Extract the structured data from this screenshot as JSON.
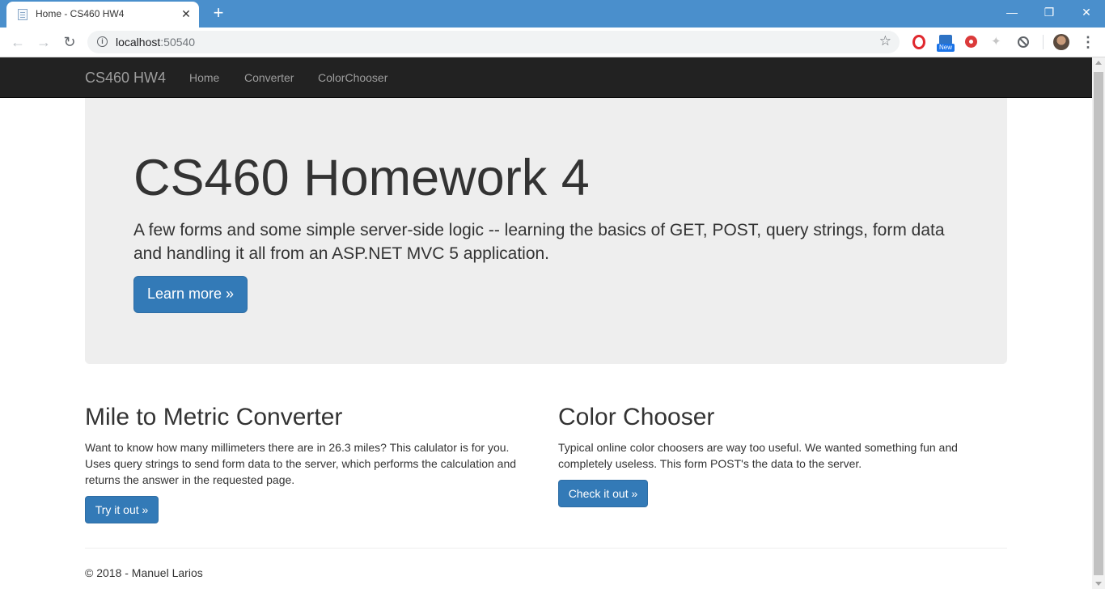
{
  "browser": {
    "tab_title": "Home - CS460 HW4",
    "tab_close": "✕",
    "new_tab": "+",
    "url_host": "localhost",
    "url_port": ":50540",
    "ext_new_label": "New",
    "window_controls": {
      "minimize": "—",
      "restore": "❐",
      "close": "✕"
    },
    "nav": {
      "back": "←",
      "forward": "→",
      "reload": "↻"
    }
  },
  "navbar": {
    "brand": "CS460 HW4",
    "links": [
      "Home",
      "Converter",
      "ColorChooser"
    ]
  },
  "jumbotron": {
    "title": "CS460 Homework 4",
    "lead": "A few forms and some simple server-side logic -- learning the basics of GET, POST, query strings, form data and handling it all from an ASP.NET MVC 5 application.",
    "button": "Learn more »"
  },
  "columns": [
    {
      "title": "Mile to Metric Converter",
      "text": "Want to know how many millimeters there are in 26.3 miles? This calulator is for you. Uses query strings to send form data to the server, which performs the calculation and returns the answer in the requested page.",
      "button": "Try it out »"
    },
    {
      "title": "Color Chooser",
      "text": "Typical online color choosers are way too useful. We wanted something fun and completely useless. This form POST's the data to the server.",
      "button": "Check it out »"
    }
  ],
  "footer": "© 2018 - Manuel Larios",
  "colors": {
    "tabbar": "#4a8fcc",
    "navbar": "#222222",
    "jumbotron": "#eeeeee",
    "primary": "#337ab7"
  }
}
